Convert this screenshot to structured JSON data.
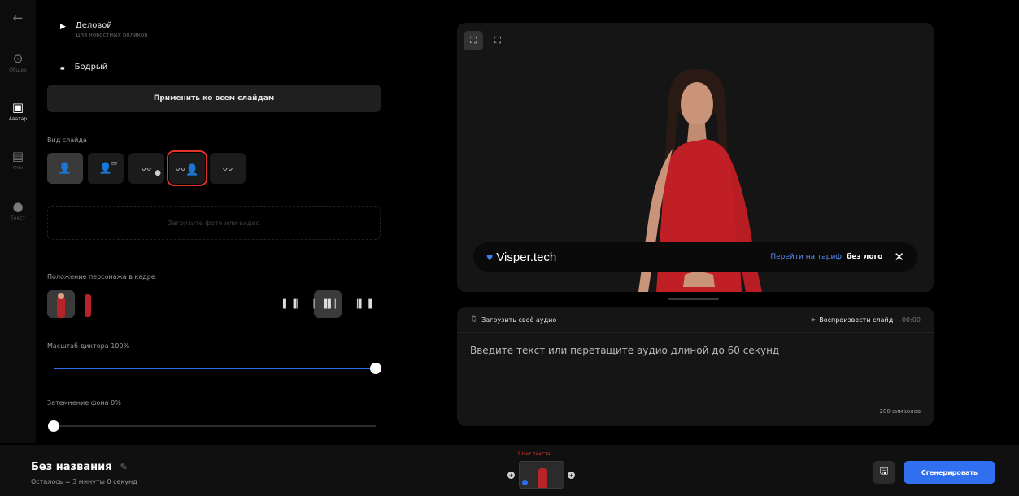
{
  "rail": {
    "back_icon": "arrow-left-icon",
    "items": [
      {
        "label": "Общее",
        "icon": "settings-circle-icon"
      },
      {
        "label": "Аватар",
        "icon": "avatar-icon"
      },
      {
        "label": "Фон",
        "icon": "background-icon"
      },
      {
        "label": "Текст",
        "icon": "text-circle-icon"
      }
    ]
  },
  "styles": [
    {
      "name": "Деловой",
      "sub": "Для новостных роликов"
    },
    {
      "name": "Бодрый",
      "sub": ""
    }
  ],
  "apply_all_label": "Применить ко всем слайдам",
  "slide_type_label": "Вид слайда",
  "slide_types": [
    "avatar",
    "avatar-with-image",
    "background-with-avatar-badge",
    "background-with-avatar",
    "background-only"
  ],
  "upload_photo_label": "Загрузите фото или видео",
  "position_label": "Положение персонажа в кадре",
  "position_options": [
    "left",
    "center",
    "right"
  ],
  "scale_label": "Масштаб диктора 100%",
  "scale_value": 100,
  "dim_label": "Затемнение фона 0%",
  "dim_value": 0,
  "preview": {
    "brand": "Visper.tech",
    "tariff_link": "Перейти на тариф",
    "no_logo": "без лого",
    "close": "✕"
  },
  "editor": {
    "upload_audio": "Загрузить своё аудио",
    "play_slide": "Воспроизвести слайд",
    "time": "~00:00",
    "placeholder": "Введите текст или перетащите аудио длиной до 60 секунд",
    "char_count": "200 символов"
  },
  "project": {
    "title": "Без названия",
    "remaining": "Осталось ≈ 3 минуты 0 секунд"
  },
  "slide_strip": {
    "label": "1 Нет текста"
  },
  "generate_label": "Сгенерировать",
  "colors": {
    "accent": "#2f6ff0",
    "highlight": "#e03226",
    "dress": "#b6242a"
  }
}
